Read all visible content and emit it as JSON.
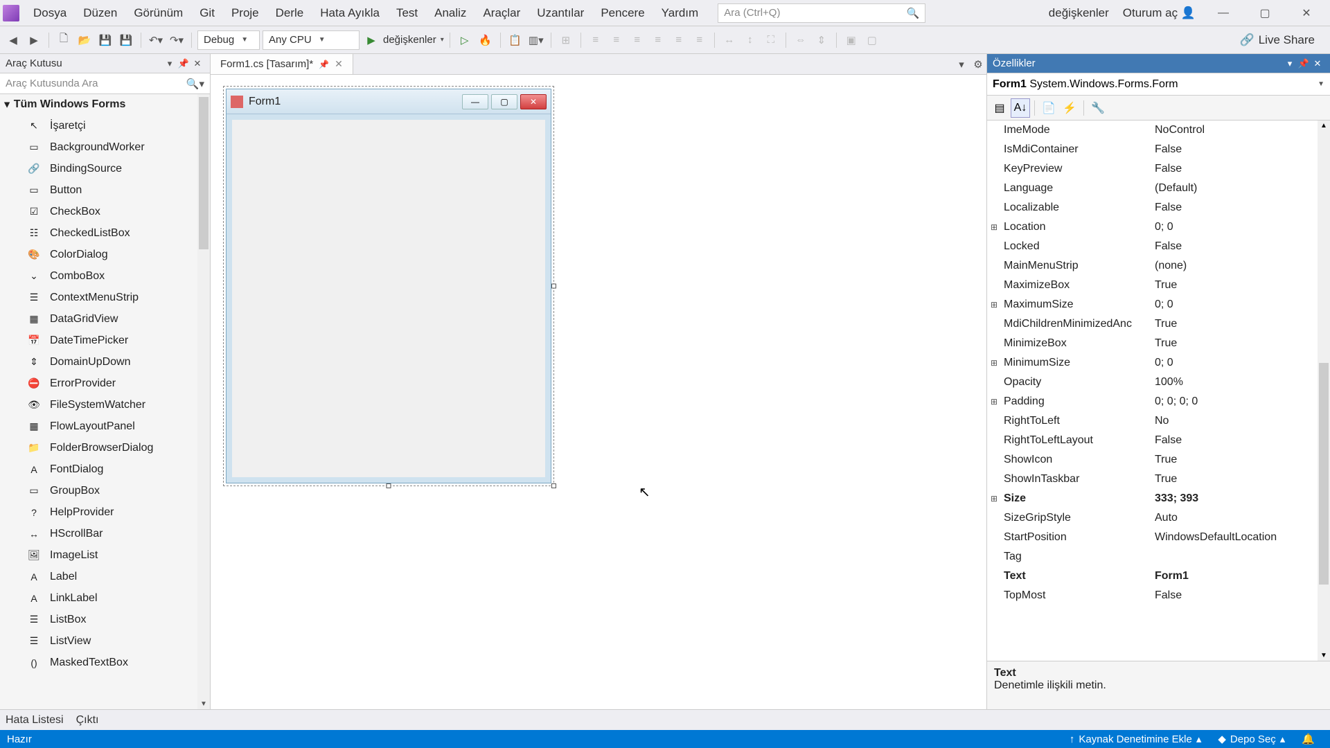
{
  "menu": {
    "items": [
      "Dosya",
      "Düzen",
      "Görünüm",
      "Git",
      "Proje",
      "Derle",
      "Hata Ayıkla",
      "Test",
      "Analiz",
      "Araçlar",
      "Uzantılar",
      "Pencere",
      "Yardım"
    ],
    "search_placeholder": "Ara (Ctrl+Q)",
    "right_label": "değişkenler",
    "signin": "Oturum aç"
  },
  "toolbar": {
    "config": "Debug",
    "platform": "Any CPU",
    "run_label": "değişkenler",
    "live_share": "Live Share"
  },
  "toolbox": {
    "title": "Araç Kutusu",
    "search_placeholder": "Araç Kutusunda Ara",
    "group": "Tüm Windows Forms",
    "items": [
      {
        "icon": "↖",
        "label": "İşaretçi"
      },
      {
        "icon": "▭",
        "label": "BackgroundWorker"
      },
      {
        "icon": "🔗",
        "label": "BindingSource"
      },
      {
        "icon": "▭",
        "label": "Button"
      },
      {
        "icon": "☑",
        "label": "CheckBox"
      },
      {
        "icon": "☷",
        "label": "CheckedListBox"
      },
      {
        "icon": "🎨",
        "label": "ColorDialog"
      },
      {
        "icon": "⌄",
        "label": "ComboBox"
      },
      {
        "icon": "☰",
        "label": "ContextMenuStrip"
      },
      {
        "icon": "▦",
        "label": "DataGridView"
      },
      {
        "icon": "📅",
        "label": "DateTimePicker"
      },
      {
        "icon": "⇕",
        "label": "DomainUpDown"
      },
      {
        "icon": "⛔",
        "label": "ErrorProvider"
      },
      {
        "icon": "👁",
        "label": "FileSystemWatcher"
      },
      {
        "icon": "▦",
        "label": "FlowLayoutPanel"
      },
      {
        "icon": "📁",
        "label": "FolderBrowserDialog"
      },
      {
        "icon": "A",
        "label": "FontDialog"
      },
      {
        "icon": "▭",
        "label": "GroupBox"
      },
      {
        "icon": "?",
        "label": "HelpProvider"
      },
      {
        "icon": "↔",
        "label": "HScrollBar"
      },
      {
        "icon": "🖼",
        "label": "ImageList"
      },
      {
        "icon": "A",
        "label": "Label"
      },
      {
        "icon": "A",
        "label": "LinkLabel"
      },
      {
        "icon": "☰",
        "label": "ListBox"
      },
      {
        "icon": "☰",
        "label": "ListView"
      },
      {
        "icon": "()",
        "label": "MaskedTextBox"
      }
    ]
  },
  "document": {
    "tab": "Form1.cs [Tasarım]*",
    "form_title": "Form1"
  },
  "properties": {
    "title": "Özellikler",
    "object_name": "Form1",
    "object_type": "System.Windows.Forms.Form",
    "rows": [
      {
        "exp": "",
        "name": "ImeMode",
        "val": "NoControl",
        "bold": false
      },
      {
        "exp": "",
        "name": "IsMdiContainer",
        "val": "False",
        "bold": false
      },
      {
        "exp": "",
        "name": "KeyPreview",
        "val": "False",
        "bold": false
      },
      {
        "exp": "",
        "name": "Language",
        "val": "(Default)",
        "bold": false
      },
      {
        "exp": "",
        "name": "Localizable",
        "val": "False",
        "bold": false
      },
      {
        "exp": "⊞",
        "name": "Location",
        "val": "0; 0",
        "bold": false
      },
      {
        "exp": "",
        "name": "Locked",
        "val": "False",
        "bold": false
      },
      {
        "exp": "",
        "name": "MainMenuStrip",
        "val": "(none)",
        "bold": false
      },
      {
        "exp": "",
        "name": "MaximizeBox",
        "val": "True",
        "bold": false
      },
      {
        "exp": "⊞",
        "name": "MaximumSize",
        "val": "0; 0",
        "bold": false
      },
      {
        "exp": "",
        "name": "MdiChildrenMinimizedAnc",
        "val": "True",
        "bold": false
      },
      {
        "exp": "",
        "name": "MinimizeBox",
        "val": "True",
        "bold": false
      },
      {
        "exp": "⊞",
        "name": "MinimumSize",
        "val": "0; 0",
        "bold": false
      },
      {
        "exp": "",
        "name": "Opacity",
        "val": "100%",
        "bold": false
      },
      {
        "exp": "⊞",
        "name": "Padding",
        "val": "0; 0; 0; 0",
        "bold": false
      },
      {
        "exp": "",
        "name": "RightToLeft",
        "val": "No",
        "bold": false
      },
      {
        "exp": "",
        "name": "RightToLeftLayout",
        "val": "False",
        "bold": false
      },
      {
        "exp": "",
        "name": "ShowIcon",
        "val": "True",
        "bold": false
      },
      {
        "exp": "",
        "name": "ShowInTaskbar",
        "val": "True",
        "bold": false
      },
      {
        "exp": "⊞",
        "name": "Size",
        "val": "333; 393",
        "bold": true
      },
      {
        "exp": "",
        "name": "SizeGripStyle",
        "val": "Auto",
        "bold": false
      },
      {
        "exp": "",
        "name": "StartPosition",
        "val": "WindowsDefaultLocation",
        "bold": false
      },
      {
        "exp": "",
        "name": "Tag",
        "val": "",
        "bold": false
      },
      {
        "exp": "",
        "name": "Text",
        "val": "Form1",
        "bold": true
      },
      {
        "exp": "",
        "name": "TopMost",
        "val": "False",
        "bold": false
      }
    ],
    "desc_title": "Text",
    "desc_body": "Denetimle ilişkili metin."
  },
  "bottom_tabs": [
    "Hata Listesi",
    "Çıktı"
  ],
  "status": {
    "left": "Hazır",
    "source": "Kaynak Denetimine Ekle",
    "repo": "Depo Seç"
  }
}
